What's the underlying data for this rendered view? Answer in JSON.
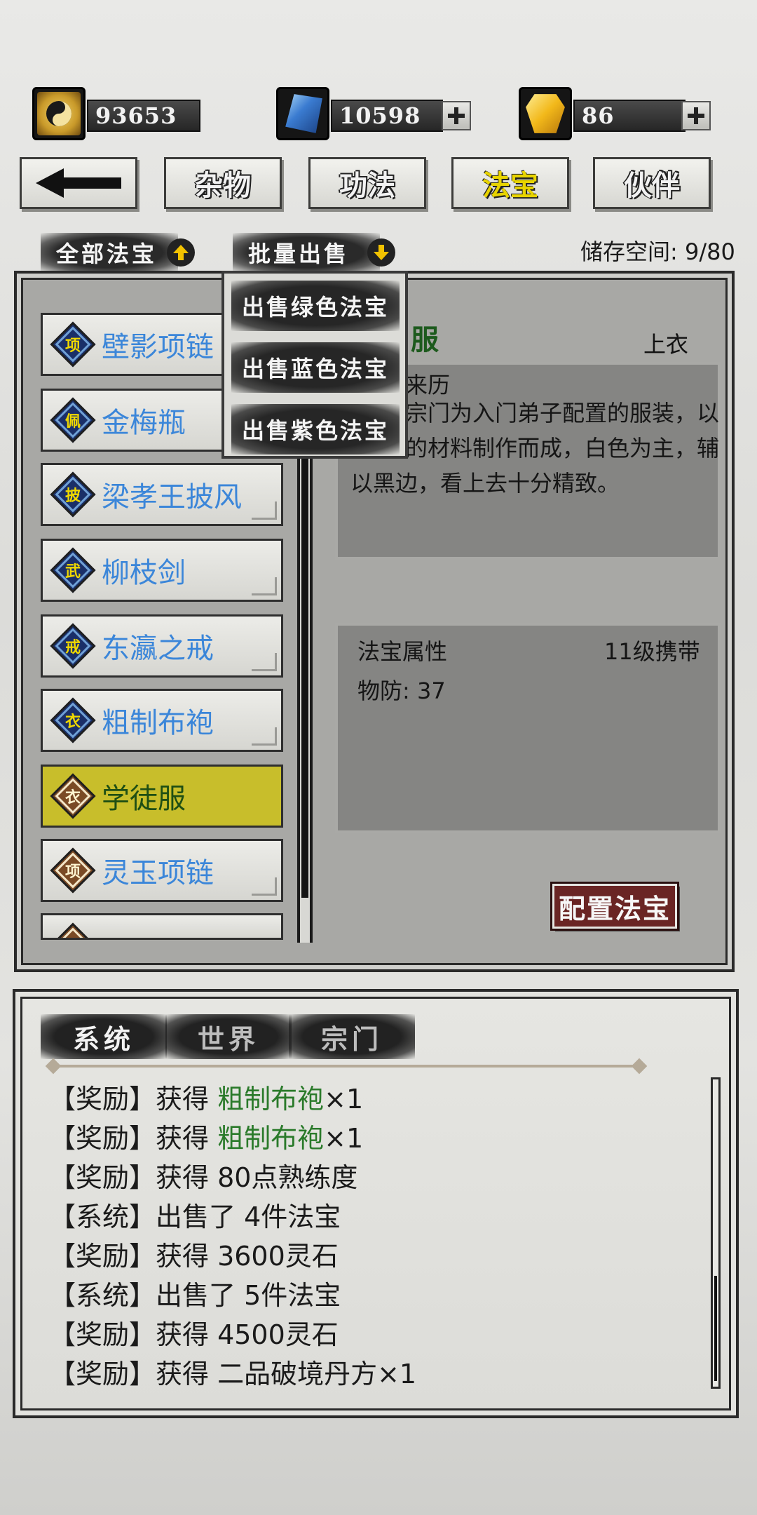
{
  "currencies": [
    {
      "name": "coin",
      "value": "93653",
      "icon": "yin-yang-coin-icon"
    },
    {
      "name": "crystal",
      "value": "10598",
      "icon": "blue-crystal-icon"
    },
    {
      "name": "gem",
      "value": "86",
      "icon": "gold-gem-icon"
    }
  ],
  "top_nav": {
    "back_icon": "back-arrow-icon",
    "tabs": [
      "杂物",
      "功法",
      "法宝",
      "伙伴"
    ],
    "active_tab": "法宝"
  },
  "filters": {
    "all_label": "全部法宝",
    "batch_sell_label": "批量出售",
    "storage": "储存空间: 9/80"
  },
  "batch_sell_menu": [
    "出售绿色法宝",
    "出售蓝色法宝",
    "出售紫色法宝"
  ],
  "items": [
    {
      "badge": "项",
      "name": "壁影项链",
      "tier": "blue"
    },
    {
      "badge": "佩",
      "name": "金梅瓶",
      "tier": "blue"
    },
    {
      "badge": "披",
      "name": "梁孝王披风",
      "tier": "blue"
    },
    {
      "badge": "武",
      "name": "柳枝剑",
      "tier": "blue"
    },
    {
      "badge": "戒",
      "name": "东瀛之戒",
      "tier": "blue"
    },
    {
      "badge": "衣",
      "name": "粗制布袍",
      "tier": "blue"
    },
    {
      "badge": "衣",
      "name": "学徒服",
      "tier": "brown",
      "selected": true
    },
    {
      "badge": "项",
      "name": "灵玉项链",
      "tier": "brown"
    },
    {
      "badge": "",
      "name": "",
      "tier": "brown"
    }
  ],
  "detail": {
    "title_partial": "服",
    "slot": "上衣",
    "history_label": "来历",
    "desc_lines": [
      "宗门为入门弟子配置的服装，以",
      "的材料制作而成，白色为主，辅",
      "以黑边，看上去十分精致。"
    ],
    "attr_label": "法宝属性",
    "level_req": "11级携带",
    "stat": "物防: 37",
    "equip_button": "配置法宝"
  },
  "chat": {
    "tabs": [
      "系统",
      "世界",
      "宗门"
    ],
    "active_tab": "系统",
    "lines": [
      {
        "prefix": "【奖励】获得 ",
        "highlight": "粗制布袍",
        "suffix": "×1"
      },
      {
        "prefix": "【奖励】获得 ",
        "highlight": "粗制布袍",
        "suffix": "×1"
      },
      {
        "prefix": "【奖励】获得 80点熟练度",
        "highlight": "",
        "suffix": ""
      },
      {
        "prefix": "【系统】出售了 4件法宝",
        "highlight": "",
        "suffix": ""
      },
      {
        "prefix": "【奖励】获得 3600灵石",
        "highlight": "",
        "suffix": ""
      },
      {
        "prefix": "【系统】出售了 5件法宝",
        "highlight": "",
        "suffix": ""
      },
      {
        "prefix": "【奖励】获得 4500灵石",
        "highlight": "",
        "suffix": ""
      },
      {
        "prefix": "【奖励】获得 二品破境丹方",
        "highlight": "",
        "suffix": "×1"
      }
    ]
  },
  "colors": {
    "item_blue_text": "#3b86d9",
    "selected_bg": "#c8be2b",
    "chat_highlight": "#2a7a2a",
    "active_tab_text": "#e8d400"
  }
}
